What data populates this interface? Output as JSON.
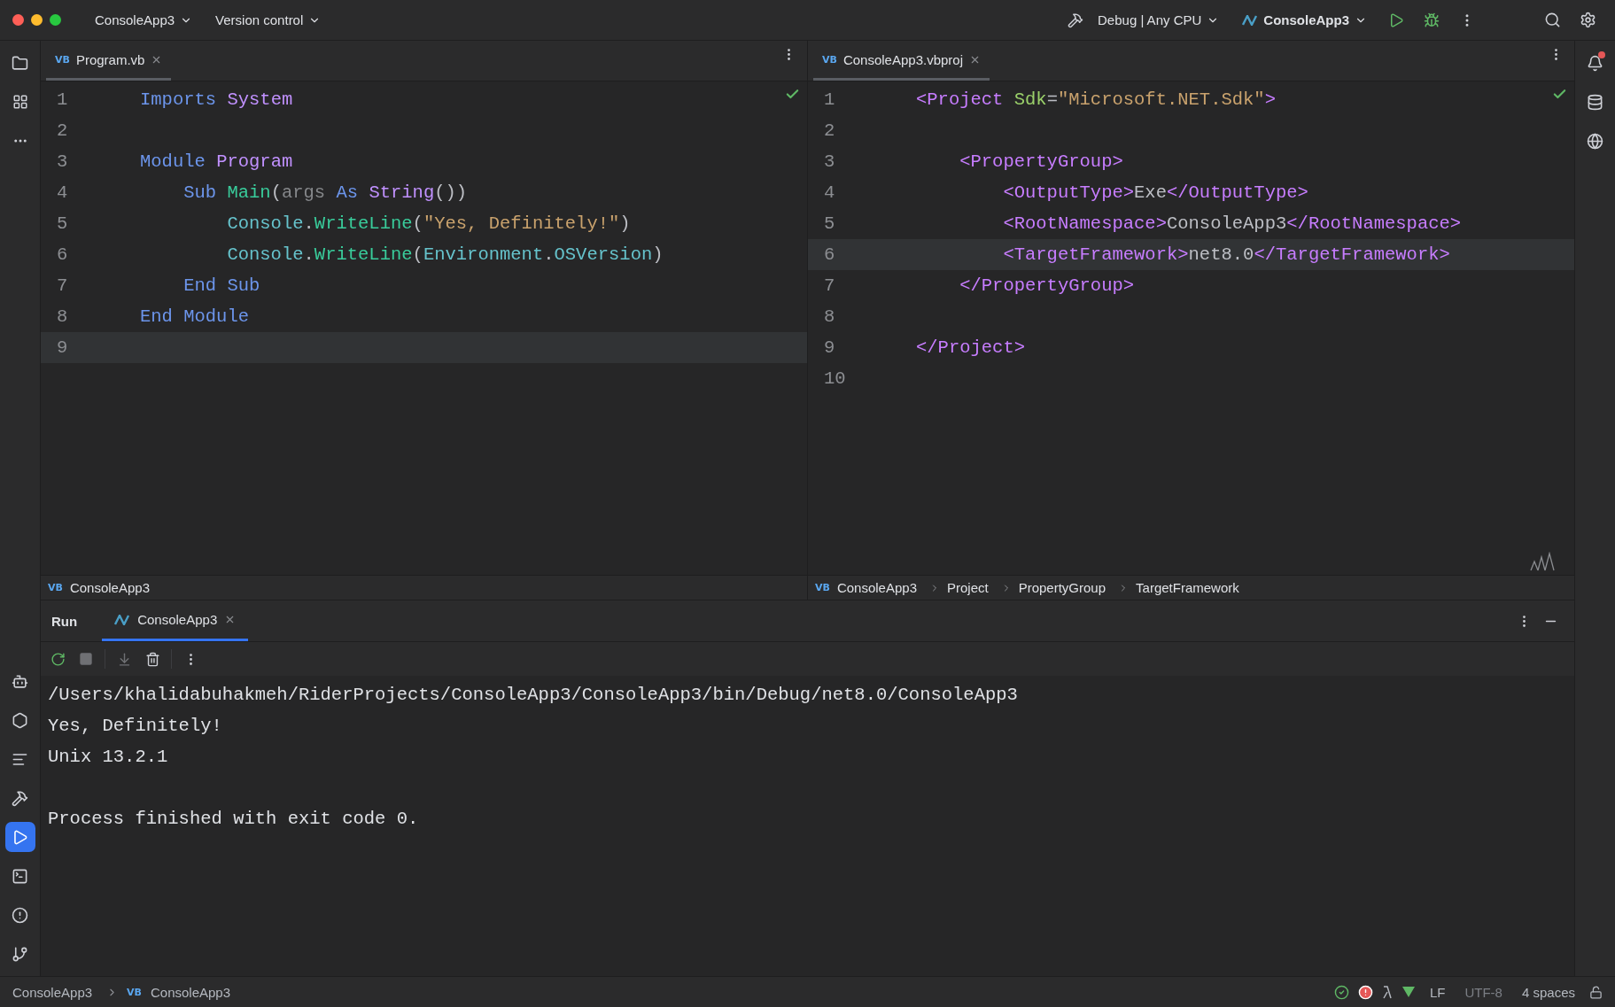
{
  "title_bar": {
    "project": "ConsoleApp3",
    "vcs": "Version control",
    "run_config": "Debug | Any CPU",
    "run_target": "ConsoleApp3"
  },
  "editors": [
    {
      "tab": {
        "badge": "VB",
        "label": "Program.vb",
        "selected": true
      },
      "inspection_ok": true,
      "lines": [
        {
          "number": "1",
          "current": false,
          "tokens": [
            {
              "kind": "keyword",
              "text": "Imports "
            },
            {
              "kind": "type",
              "text": "System"
            }
          ]
        },
        {
          "number": "2",
          "current": false
        },
        {
          "number": "3",
          "current": false,
          "tokens": [
            {
              "kind": "keyword",
              "text": "Module "
            },
            {
              "kind": "type",
              "text": "Program"
            }
          ]
        },
        {
          "number": "4",
          "current": false,
          "tokens": [
            {
              "kind": "keyword",
              "text": "    Sub "
            },
            {
              "kind": "method",
              "text": "Main"
            },
            {
              "kind": "plain",
              "text": "("
            },
            {
              "kind": "param",
              "text": "args "
            },
            {
              "kind": "keyword",
              "text": "As "
            },
            {
              "kind": "type",
              "text": "String"
            },
            {
              "kind": "plain",
              "text": "())"
            }
          ]
        },
        {
          "number": "5",
          "current": false,
          "tokens": [
            {
              "kind": "class",
              "text": "        Console"
            },
            {
              "kind": "plain",
              "text": "."
            },
            {
              "kind": "method",
              "text": "WriteLine"
            },
            {
              "kind": "plain",
              "text": "("
            },
            {
              "kind": "string",
              "text": "\"Yes, Definitely!\""
            },
            {
              "kind": "plain",
              "text": ")"
            }
          ]
        },
        {
          "number": "6",
          "current": false,
          "tokens": [
            {
              "kind": "class",
              "text": "        Console"
            },
            {
              "kind": "plain",
              "text": "."
            },
            {
              "kind": "method",
              "text": "WriteLine"
            },
            {
              "kind": "plain",
              "text": "("
            },
            {
              "kind": "class",
              "text": "Environment"
            },
            {
              "kind": "plain",
              "text": "."
            },
            {
              "kind": "property",
              "text": "OSVersion"
            },
            {
              "kind": "plain",
              "text": ")"
            }
          ]
        },
        {
          "number": "7",
          "current": false,
          "tokens": [
            {
              "kind": "keyword",
              "text": "    End Sub"
            }
          ]
        },
        {
          "number": "8",
          "current": false,
          "tokens": [
            {
              "kind": "keyword",
              "text": "End Module"
            }
          ]
        },
        {
          "number": "9",
          "current": true
        }
      ],
      "breadcrumbs": [
        {
          "badge": "VB",
          "label": "ConsoleApp3"
        }
      ]
    },
    {
      "tab": {
        "badge": "VB",
        "label": "ConsoleApp3.vbproj",
        "selected": true
      },
      "inspection_ok": true,
      "lines": [
        {
          "number": "1",
          "current": false,
          "tokens": [
            {
              "kind": "tag",
              "text": "<Project "
            },
            {
              "kind": "attr",
              "text": "Sdk"
            },
            {
              "kind": "plain",
              "text": "="
            },
            {
              "kind": "string",
              "text": "\"Microsoft.NET.Sdk\""
            },
            {
              "kind": "tag",
              "text": ">"
            }
          ]
        },
        {
          "number": "2",
          "current": false
        },
        {
          "number": "3",
          "current": false,
          "tokens": [
            {
              "kind": "tag",
              "text": "    <PropertyGroup>"
            }
          ]
        },
        {
          "number": "4",
          "current": false,
          "tokens": [
            {
              "kind": "tag",
              "text": "        <OutputType>"
            },
            {
              "kind": "plain",
              "text": "Exe"
            },
            {
              "kind": "tag",
              "text": "</OutputType>"
            }
          ]
        },
        {
          "number": "5",
          "current": false,
          "tokens": [
            {
              "kind": "tag",
              "text": "        <RootNamespace>"
            },
            {
              "kind": "plain",
              "text": "ConsoleApp3"
            },
            {
              "kind": "tag",
              "text": "</RootNamespace>"
            }
          ]
        },
        {
          "number": "6",
          "current": true,
          "tokens": [
            {
              "kind": "tag",
              "text": "        <TargetFramework>"
            },
            {
              "kind": "plain",
              "text": "net8.0"
            },
            {
              "kind": "tag",
              "text": "</TargetFramework>"
            }
          ]
        },
        {
          "number": "7",
          "current": false,
          "tokens": [
            {
              "kind": "tag",
              "text": "    </PropertyGroup>"
            }
          ]
        },
        {
          "number": "8",
          "current": false
        },
        {
          "number": "9",
          "current": false,
          "tokens": [
            {
              "kind": "tag",
              "text": "</Project>"
            }
          ]
        },
        {
          "number": "10",
          "current": false
        }
      ],
      "breadcrumbs": [
        {
          "badge": "VB",
          "label": "ConsoleApp3"
        },
        {
          "label": "Project"
        },
        {
          "label": "PropertyGroup"
        },
        {
          "label": "TargetFramework"
        }
      ]
    }
  ],
  "run_panel": {
    "title": "Run",
    "tabs": [
      {
        "label": "ConsoleApp3",
        "selected": true
      }
    ],
    "output": [
      "/Users/khalidabuhakmeh/RiderProjects/ConsoleApp3/ConsoleApp3/bin/Debug/net8.0/ConsoleApp3",
      "Yes, Definitely!",
      "Unix 13.2.1"
    ],
    "exit_message": "Process finished with exit code 0."
  },
  "status_bar": {
    "breadcrumbs": [
      {
        "label": "ConsoleApp3"
      },
      {
        "badge": "VB",
        "label": "ConsoleApp3"
      }
    ],
    "line_separator": "LF",
    "encoding": "UTF-8",
    "indent": "4 spaces"
  }
}
